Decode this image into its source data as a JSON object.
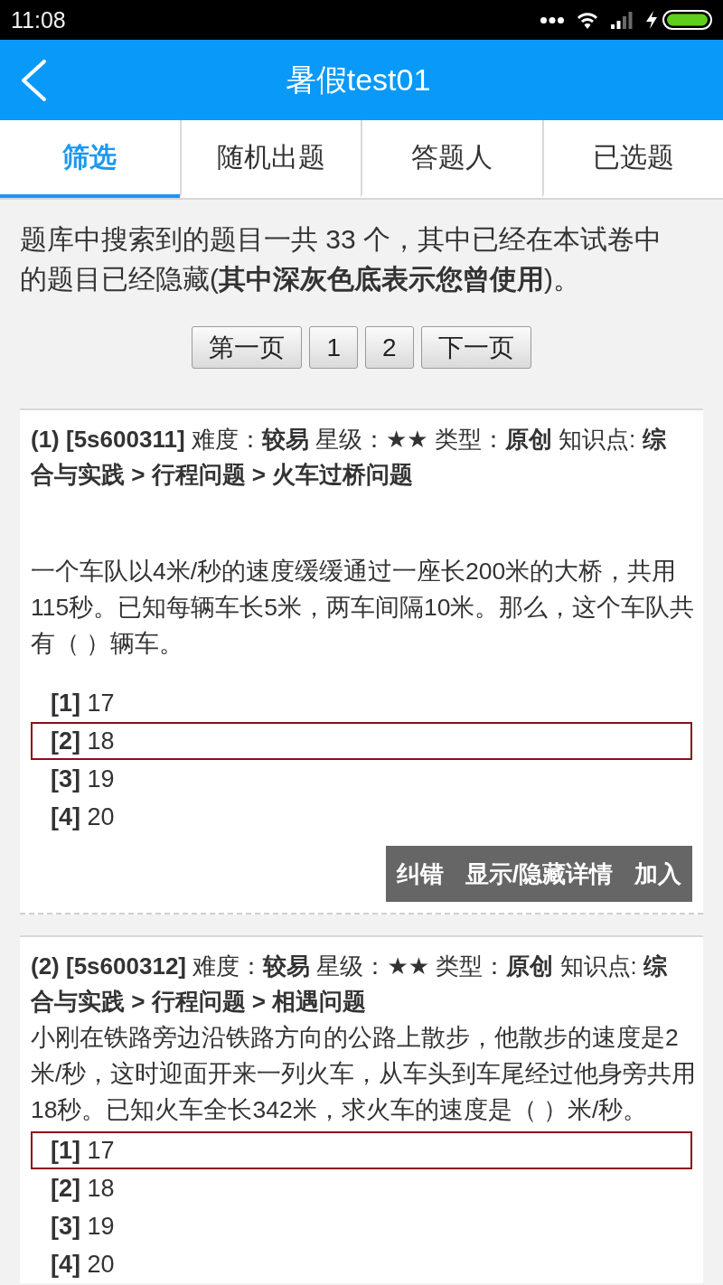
{
  "status_bar": {
    "time": "11:08"
  },
  "app_bar": {
    "title": "暑假test01"
  },
  "tabs": [
    {
      "label": "筛选",
      "selected": true
    },
    {
      "label": "随机出题",
      "selected": false
    },
    {
      "label": "答题人",
      "selected": false
    },
    {
      "label": "已选题",
      "selected": false
    }
  ],
  "summary": "题库中搜索到的题目一共 33 个，其中已经在本试卷中的题目已经隐藏(**其中深灰色底表示您曾使用**)。",
  "pager": [
    "第一页",
    "1",
    "2",
    "下一页"
  ],
  "questions": [
    {
      "header": "**(1) [5s600311]** 难度：**较易** 星级：**★★** 类型：**原创** 知识点: **综合与实践 > 行程问题 > 火车过桥问题**",
      "body": "一个车队以4米/秒的速度缓缓通过一座长200米的大桥，共用115秒。已知每辆车长5米，两车间隔10米。那么，这个车队共有（ ）辆车。",
      "options": [
        {
          "number": "[1]",
          "text": "17",
          "correct": false
        },
        {
          "number": "[2]",
          "text": "18",
          "correct": true
        },
        {
          "number": "[3]",
          "text": "19",
          "correct": false
        },
        {
          "number": "[4]",
          "text": "20",
          "correct": false
        }
      ],
      "actions": [
        "纠错",
        "显示/隐藏详情",
        "加入"
      ]
    },
    {
      "header": "**(2) [5s600312]** 难度：**较易** 星级：**★★** 类型：**原创** 知识点: **综合与实践 > 行程问题 > 相遇问题**",
      "body": "小刚在铁路旁边沿铁路方向的公路上散步，他散步的速度是2米/秒，这时迎面开来一列火车，从车头到车尾经过他身旁共用18秒。已知火车全长342米，求火车的速度是（ ）米/秒。",
      "options": [
        {
          "number": "[1]",
          "text": "17",
          "correct": true
        },
        {
          "number": "[2]",
          "text": "18",
          "correct": false
        },
        {
          "number": "[3]",
          "text": "19",
          "correct": false
        },
        {
          "number": "[4]",
          "text": "20",
          "correct": false
        }
      ]
    }
  ]
}
